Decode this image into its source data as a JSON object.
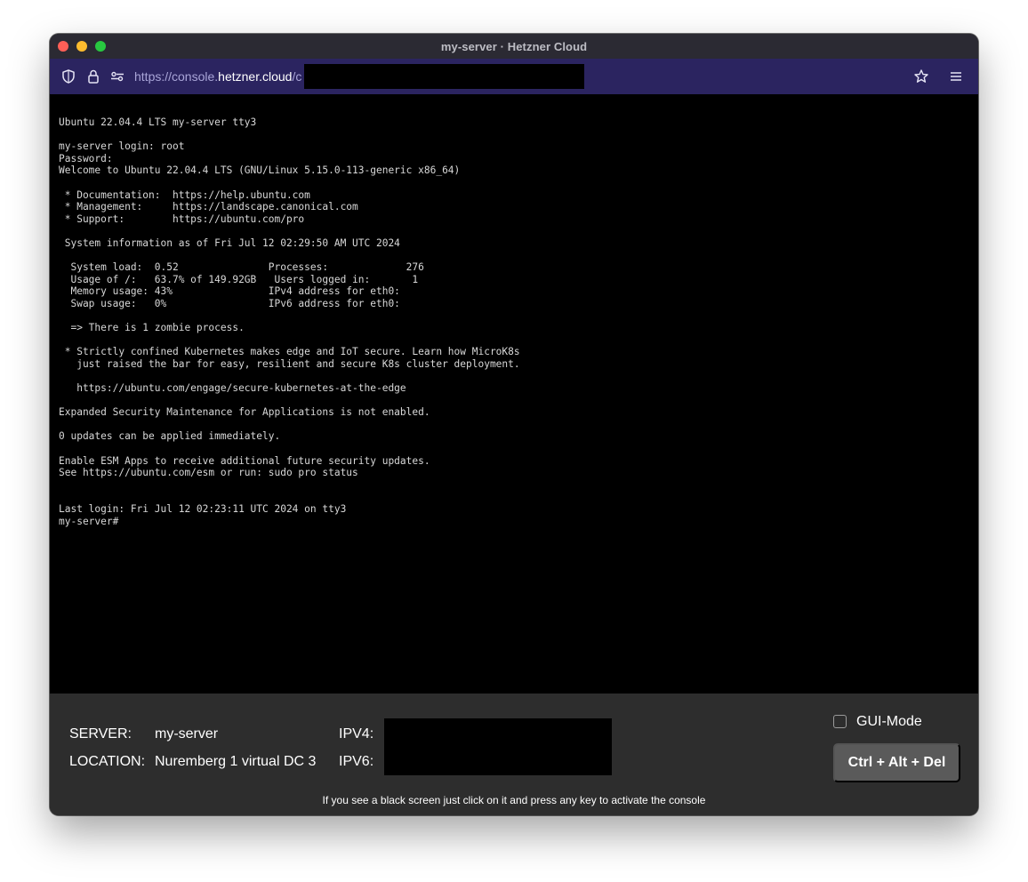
{
  "window": {
    "title": "my-server · Hetzner Cloud"
  },
  "browser": {
    "url_prefix": "https://console.",
    "url_host": "hetzner.cloud",
    "url_suffix": "/c",
    "icons": [
      "shield-icon",
      "lock-icon",
      "site-permissions-icon",
      "bookmark-star-icon",
      "menu-icon"
    ]
  },
  "terminal": {
    "lines": [
      "Ubuntu 22.04.4 LTS my-server tty3",
      "",
      "my-server login: root",
      "Password:",
      "Welcome to Ubuntu 22.04.4 LTS (GNU/Linux 5.15.0-113-generic x86_64)",
      "",
      " * Documentation:  https://help.ubuntu.com",
      " * Management:     https://landscape.canonical.com",
      " * Support:        https://ubuntu.com/pro",
      "",
      " System information as of Fri Jul 12 02:29:50 AM UTC 2024",
      "",
      "  System load:  0.52               Processes:             276",
      "  Usage of /:   63.7% of 149.92GB   Users logged in:       1",
      "  Memory usage: 43%                IPv4 address for eth0: ",
      "  Swap usage:   0%                 IPv6 address for eth0: ",
      "",
      "  => There is 1 zombie process.",
      "",
      " * Strictly confined Kubernetes makes edge and IoT secure. Learn how MicroK8s",
      "   just raised the bar for easy, resilient and secure K8s cluster deployment.",
      "",
      "   https://ubuntu.com/engage/secure-kubernetes-at-the-edge",
      "",
      "Expanded Security Maintenance for Applications is not enabled.",
      "",
      "0 updates can be applied immediately.",
      "",
      "Enable ESM Apps to receive additional future security updates.",
      "See https://ubuntu.com/esm or run: sudo pro status",
      "",
      "",
      "Last login: Fri Jul 12 02:23:11 UTC 2024 on tty3",
      "my-server#"
    ]
  },
  "footer": {
    "server_label": "SERVER:",
    "server_value": "my-server",
    "location_label": "LOCATION:",
    "location_value": "Nuremberg 1 virtual DC 3",
    "ipv4_label": "IPV4:",
    "ipv6_label": "IPV6:",
    "gui_mode_label": "GUI-Mode",
    "gui_mode_checked": false,
    "cad_button_label": "Ctrl + Alt + Del",
    "hint": "If you see a black screen just click on it and press any key to activate the console"
  }
}
